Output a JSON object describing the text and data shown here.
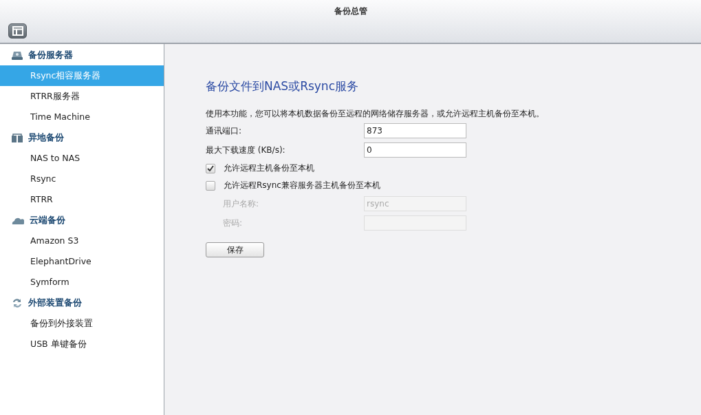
{
  "window": {
    "title": "备份总管"
  },
  "sidebar": {
    "groups": [
      {
        "label": "备份服务器",
        "kind": "server",
        "items": [
          {
            "label": "Rsync相容服务器",
            "selected": true
          },
          {
            "label": "RTRR服务器",
            "selected": false
          },
          {
            "label": "Time Machine",
            "selected": false
          }
        ]
      },
      {
        "label": "异地备份",
        "kind": "remote",
        "items": [
          {
            "label": "NAS to NAS",
            "selected": false
          },
          {
            "label": "Rsync",
            "selected": false
          },
          {
            "label": "RTRR",
            "selected": false
          }
        ]
      },
      {
        "label": "云端备份",
        "kind": "cloud",
        "items": [
          {
            "label": "Amazon S3",
            "selected": false
          },
          {
            "label": "ElephantDrive",
            "selected": false
          },
          {
            "label": "Symform",
            "selected": false
          }
        ]
      },
      {
        "label": "外部装置备份",
        "kind": "sync",
        "items": [
          {
            "label": "备份到外接装置",
            "selected": false
          },
          {
            "label": "USB 单键备份",
            "selected": false
          }
        ]
      }
    ]
  },
  "content": {
    "heading": "备份文件到NAS或Rsync服务",
    "description": "使用本功能，您可以将本机数据备份至远程的网络储存服务器，或允许远程主机备份至本机。",
    "fields": [
      {
        "kind": "text",
        "label": "通讯端口:",
        "value": "873",
        "disabled": false
      },
      {
        "kind": "text",
        "label": "最大下载速度 (KB/s):",
        "value": "0",
        "disabled": false
      },
      {
        "kind": "checkbox",
        "label": "允许远程主机备份至本机",
        "checked": true
      },
      {
        "kind": "checkbox",
        "label": "允许远程Rsync兼容服务器主机备份至本机",
        "checked": false
      },
      {
        "kind": "text",
        "label": "用户名称:",
        "value": "rsync",
        "disabled": true
      },
      {
        "kind": "text",
        "label": "密码:",
        "disabled": true
      }
    ],
    "save_button": "保存"
  }
}
